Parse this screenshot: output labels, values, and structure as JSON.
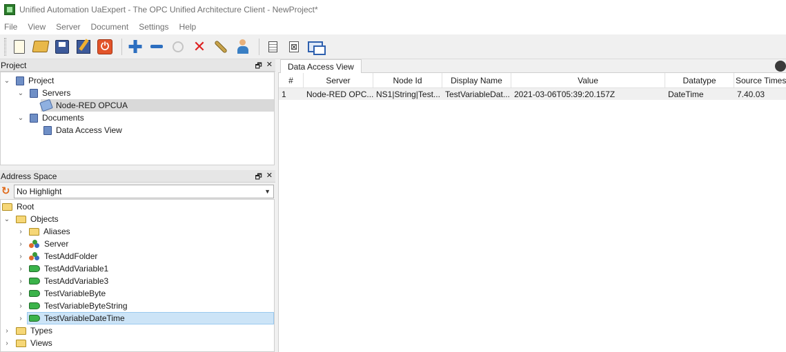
{
  "window": {
    "title": "Unified Automation UaExpert - The OPC Unified Architecture Client - NewProject*"
  },
  "menu": [
    "File",
    "View",
    "Server",
    "Document",
    "Settings",
    "Help"
  ],
  "toolbar": {
    "buttons": [
      "new-icon",
      "open-icon",
      "save-icon",
      "save-as-icon",
      "power-icon",
      "plus-icon",
      "minus-icon",
      "connect-icon",
      "delete-icon",
      "wrench-icon",
      "user-icon",
      "document-icon",
      "document-x-icon",
      "windows-icon"
    ],
    "plus_glyph": "✚",
    "delete_glyph": "✕",
    "power_glyph": "⏻",
    "doc_x_glyph": "⊠"
  },
  "panel_buttons": {
    "float": "🗗",
    "close": "✕"
  },
  "project_panel": {
    "title": "Project",
    "items": [
      {
        "label": "Project",
        "chevron": "⌄"
      },
      {
        "label": "Servers",
        "chevron": "⌄"
      },
      {
        "label": "Node-RED OPCUA"
      },
      {
        "label": "Documents",
        "chevron": "⌄"
      },
      {
        "label": "Data Access View"
      }
    ]
  },
  "address_panel": {
    "title": "Address Space",
    "highlight": {
      "value": "No Highlight",
      "arrow": "▼",
      "refresh": "↻"
    },
    "items": [
      {
        "label": "Root"
      },
      {
        "label": "Objects",
        "chevron": "⌄"
      },
      {
        "label": "Aliases",
        "chevron": "›"
      },
      {
        "label": "Server",
        "chevron": "›"
      },
      {
        "label": "TestAddFolder",
        "chevron": "›"
      },
      {
        "label": "TestAddVariable1",
        "chevron": "›"
      },
      {
        "label": "TestAddVariable3",
        "chevron": "›"
      },
      {
        "label": "TestVariableByte",
        "chevron": "›"
      },
      {
        "label": "TestVariableByteString",
        "chevron": "›"
      },
      {
        "label": "TestVariableDateTime",
        "chevron": "›"
      },
      {
        "label": "Types",
        "chevron": "›"
      },
      {
        "label": "Views",
        "chevron": "›"
      }
    ]
  },
  "data_access": {
    "tab": "Data Access View",
    "columns": [
      "#",
      "Server",
      "Node Id",
      "Display Name",
      "Value",
      "Datatype",
      "Source Timest"
    ],
    "rows": [
      [
        "1",
        "Node-RED OPC...",
        "NS1|String|Test...",
        "TestVariableDat...",
        "2021-03-06T05:39:20.157Z",
        "DateTime",
        "7.40.03"
      ]
    ]
  }
}
